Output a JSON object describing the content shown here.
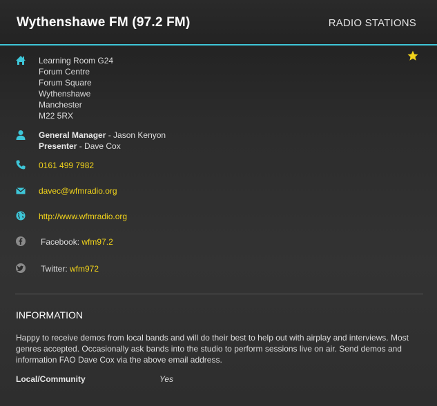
{
  "header": {
    "title": "Wythenshawe FM (97.2 FM)",
    "category": "RADIO STATIONS"
  },
  "favorite": {
    "icon": "star-icon",
    "color": "#f2d41b"
  },
  "address": {
    "icon": "home-icon",
    "lines": [
      "Learning Room G24",
      "Forum Centre",
      "Forum Square",
      "Wythenshawe",
      "Manchester",
      "M22 5RX"
    ]
  },
  "contacts": {
    "icon": "person-icon",
    "people": [
      {
        "role": "General Manager",
        "sep": " - ",
        "name": "Jason Kenyon"
      },
      {
        "role": "Presenter",
        "sep": " - ",
        "name": "Dave Cox"
      }
    ]
  },
  "phone": {
    "icon": "phone-icon",
    "value": "0161 499 7982"
  },
  "email": {
    "icon": "envelope-icon",
    "value": "davec@wfmradio.org"
  },
  "website": {
    "icon": "globe-icon",
    "value": "http://www.wfmradio.org"
  },
  "facebook": {
    "icon": "facebook-icon",
    "label": "Facebook:",
    "value": "wfm97.2"
  },
  "twitter": {
    "icon": "twitter-icon",
    "label": "Twitter:",
    "value": "wfm972"
  },
  "information": {
    "title": "INFORMATION",
    "text": "Happy to receive demos from local bands and will do their best to help out with airplay and interviews. Most genres accepted. Occasionally ask bands into the studio to perform sessions live on air. Send demos and information FAO Dave Cox via the above email address.",
    "attributes": [
      {
        "label": "Local/Community",
        "value": "Yes"
      }
    ]
  },
  "colors": {
    "accent": "#3ec6d8",
    "link": "#f2d41b",
    "icon_cyan": "#3ec6d8",
    "icon_grey": "#8a8a8a"
  }
}
